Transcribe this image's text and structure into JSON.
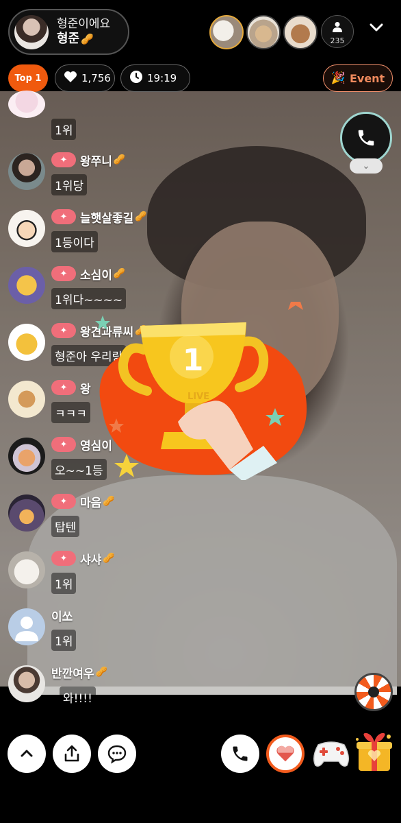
{
  "header": {
    "streamer_subtitle": "형준이에요",
    "streamer_name": "형준",
    "viewer_count": "235",
    "rank_badge": "Top 1",
    "likes": "1,756",
    "elapsed_time": "19:19",
    "event_label": "Event"
  },
  "chat": [
    {
      "nick": "",
      "text": "1위",
      "has_badge": true,
      "avatar": "pink-character"
    },
    {
      "nick": "왕쭈니",
      "text": "1위당",
      "has_badge": true,
      "avatar": "man-photo"
    },
    {
      "nick": "늘햇살좋길",
      "text": "1등이다",
      "has_badge": true,
      "avatar": "cartoon-boy"
    },
    {
      "nick": "소심이",
      "text": "1위다~~~~",
      "has_badge": true,
      "avatar": "yellow-chick"
    },
    {
      "nick": "왕견과류씨",
      "text": "형준아 우리랑",
      "has_badge": true,
      "avatar": "peanut-character"
    },
    {
      "nick": "왕",
      "text": "ㅋㅋㅋ",
      "has_badge": true,
      "avatar": "peanut-sticker"
    },
    {
      "nick": "영심이",
      "text": "오~~1등",
      "has_badge": true,
      "avatar": "rabbit-fox"
    },
    {
      "nick": "마음",
      "text": "탑텐",
      "has_badge": true,
      "avatar": "lamp"
    },
    {
      "nick": "샤샤",
      "text": "1위",
      "has_badge": true,
      "avatar": "white-cat"
    },
    {
      "nick": "이쏘",
      "text": "1위",
      "has_badge": false,
      "avatar": "default-user"
    },
    {
      "nick": "반깐여우",
      "text": "와!!!!",
      "has_badge": false,
      "avatar": "man-photo-2"
    }
  ],
  "trophy": {
    "rank_number": "1",
    "caption": "LIVE"
  },
  "colors": {
    "accent_orange": "#f05a0e",
    "badge_pink": "#f06e7a",
    "event_text": "#f08a5d",
    "nut_gold": "#e1a646"
  },
  "icons": {
    "chat_badge": "sparkle-icon",
    "nick_suffix": "peanut-icon"
  }
}
